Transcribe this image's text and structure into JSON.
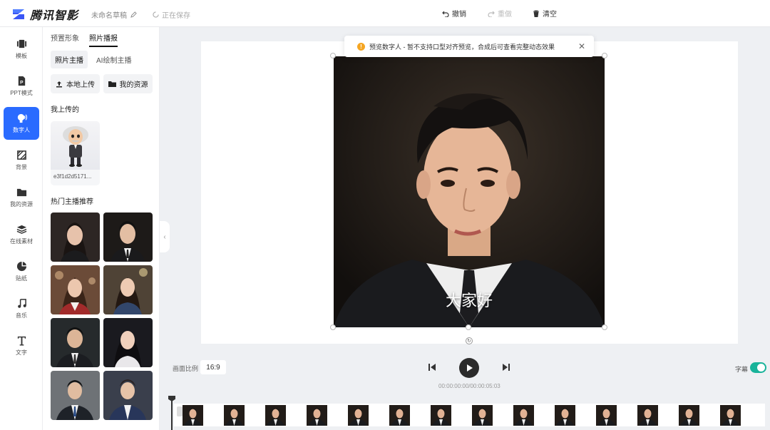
{
  "app": {
    "name": "腾讯智影",
    "brand_color": "#2a6bff"
  },
  "document": {
    "title": "未命名草稿",
    "status": "正在保存"
  },
  "toolbar": {
    "undo": "撤销",
    "redo": "重做",
    "clear": "清空"
  },
  "sidebar": {
    "items": [
      {
        "label": "模板",
        "icon": "template-icon"
      },
      {
        "label": "PPT模式",
        "icon": "ppt-icon"
      },
      {
        "label": "数字人",
        "icon": "digital-human-icon",
        "active": true
      },
      {
        "label": "背景",
        "icon": "background-icon"
      },
      {
        "label": "我的资源",
        "icon": "folder-icon"
      },
      {
        "label": "在线素材",
        "icon": "layers-icon"
      },
      {
        "label": "贴纸",
        "icon": "sticker-icon"
      },
      {
        "label": "音乐",
        "icon": "music-icon"
      },
      {
        "label": "文字",
        "icon": "text-icon"
      }
    ]
  },
  "panel": {
    "tabs": [
      "预置形象",
      "照片播报"
    ],
    "active_tab": 1,
    "subtabs": [
      "照片主播",
      "AI绘制主播"
    ],
    "active_subtab": 0,
    "local_upload": "本地上传",
    "my_resources": "我的资源",
    "uploaded_label": "我上传的",
    "uploaded_file": "e3f1d2d5171...",
    "hot_label": "热门主播推荐"
  },
  "canvas": {
    "toast": "预览数字人 - 暂不支持口型对齐预览，合成后可查看完整动态效果",
    "subtitle_text": "大家好"
  },
  "controls": {
    "ratio_label": "画面比例",
    "ratio_value": "16:9",
    "time": "00:00:00:00/00:00:05:03",
    "subtitles_label": "字幕",
    "subtitles_on": true
  }
}
